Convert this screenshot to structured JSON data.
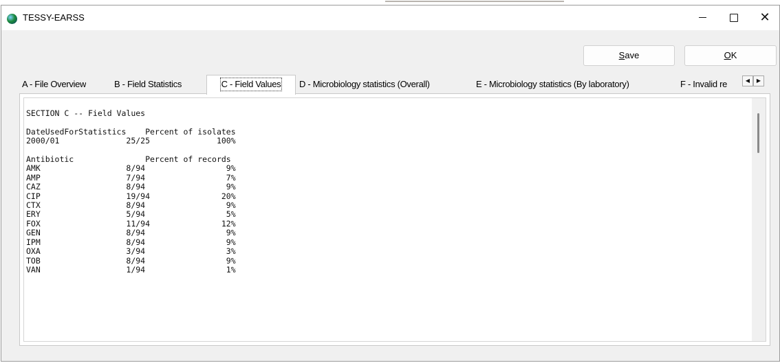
{
  "window": {
    "title": "TESSY-EARSS",
    "app_icon": "globe-icon",
    "controls": {
      "minimize": "minimize-icon",
      "maximize": "maximize-icon",
      "close": "close-icon"
    }
  },
  "toolbar": {
    "save_label_accel": "S",
    "save_label_rest": "ave",
    "ok_label_accel": "O",
    "ok_label_rest": "K"
  },
  "tabs": [
    {
      "label": "A - File Overview",
      "active": false
    },
    {
      "label": "B - Field Statistics",
      "active": false
    },
    {
      "label": "C - Field Values",
      "active": true
    },
    {
      "label": "D - Microbiology statistics (Overall)",
      "active": false
    },
    {
      "label": "E - Microbiology statistics (By laboratory)",
      "active": false
    },
    {
      "label": "F - Invalid re",
      "active": false
    }
  ],
  "tab_scroll": {
    "left": "◀",
    "right": "▶"
  },
  "report": {
    "section_title": "SECTION C -- Field Values",
    "date_header": {
      "col1": "DateUsedForStatistics",
      "col2": "Percent of isolates"
    },
    "date_rows": [
      {
        "key": "2000/01",
        "ratio": "25/25",
        "percent": "100%"
      }
    ],
    "antibiotic_header": {
      "col1": "Antibiotic",
      "col2": "Percent of records"
    },
    "antibiotic_rows": [
      {
        "key": "AMK",
        "ratio": "8/94",
        "percent": "9%"
      },
      {
        "key": "AMP",
        "ratio": "7/94",
        "percent": "7%"
      },
      {
        "key": "CAZ",
        "ratio": "8/94",
        "percent": "9%"
      },
      {
        "key": "CIP",
        "ratio": "19/94",
        "percent": "20%"
      },
      {
        "key": "CTX",
        "ratio": "8/94",
        "percent": "9%"
      },
      {
        "key": "ERY",
        "ratio": "5/94",
        "percent": "5%"
      },
      {
        "key": "FOX",
        "ratio": "11/94",
        "percent": "12%"
      },
      {
        "key": "GEN",
        "ratio": "8/94",
        "percent": "9%"
      },
      {
        "key": "IPM",
        "ratio": "8/94",
        "percent": "9%"
      },
      {
        "key": "OXA",
        "ratio": "3/94",
        "percent": "3%"
      },
      {
        "key": "TOB",
        "ratio": "8/94",
        "percent": "9%"
      },
      {
        "key": "VAN",
        "ratio": "1/94",
        "percent": "1%"
      }
    ]
  }
}
